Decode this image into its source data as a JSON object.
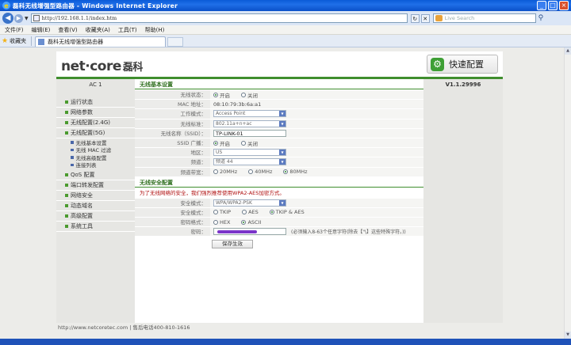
{
  "window": {
    "title": "磊科无线增强型路由器 - Windows Internet Explorer"
  },
  "address": {
    "url": "http://192.168.1.1/index.htm",
    "search_placeholder": "Live Search"
  },
  "menubar": [
    "文件(F)",
    "编辑(E)",
    "查看(V)",
    "收藏夹(A)",
    "工具(T)",
    "帮助(H)"
  ],
  "favorites": {
    "label": "收藏夹",
    "tab_title": "磊科无线增强型路由器"
  },
  "header": {
    "logo": "net·core",
    "logo_cn": "磊科",
    "quick_config": "快速配置"
  },
  "left": {
    "model": "AC 1",
    "menu": [
      {
        "label": "运行状态"
      },
      {
        "label": "网络参数"
      },
      {
        "label": "无线配置(2.4G)"
      },
      {
        "label": "无线配置(5G)"
      }
    ],
    "submenu": [
      "无线基本设置",
      "无线 MAC 过滤",
      "无线高级配置",
      "连接列表"
    ],
    "menu2": [
      "QoS 配置",
      "端口转发配置",
      "网络安全",
      "动态域名",
      "高级配置",
      "系统工具"
    ]
  },
  "right": {
    "version": "V1.1.29996"
  },
  "basic": {
    "title": "无线基本设置",
    "status_label": "无线状态：",
    "status_on": "开启",
    "status_off": "关闭",
    "mac_label": "MAC 地址：",
    "mac_value": "08:10:79:3b:6a:a1",
    "mode_label": "工作模式：",
    "mode_value": "Access Point",
    "std_label": "无线标准：",
    "std_value": "802.11a+n+ac",
    "ssid_label": "无线名称（SSID）：",
    "ssid_value": "TP-LINK-01",
    "bcast_label": "SSID 广播：",
    "bcast_on": "开启",
    "bcast_off": "关闭",
    "region_label": "地区：",
    "region_value": "US",
    "channel_label": "频道：",
    "channel_value": "频道 44",
    "bw_label": "频道带宽：",
    "bw_20": "20MHz",
    "bw_40": "40MHz",
    "bw_80": "80MHz"
  },
  "security": {
    "title": "无线安全配置",
    "warning": "为了无线网络的安全，我们强烈推荐使用WPA2-AES加密方式。",
    "mode_label": "安全模式：",
    "mode_value": "WPA/WPA2-PSK",
    "algo_label": "安全模式：",
    "algo_tkip": "TKIP",
    "algo_aes": "AES",
    "algo_both": "TKIP & AES",
    "fmt_label": "密码格式：",
    "fmt_hex": "HEX",
    "fmt_ascii": "ASCII",
    "pw_label": "密码：",
    "pw_hint": "(必须输入8-63个任意字符(除去【\"\\】这些特殊字符。))",
    "save": "保存生效"
  },
  "footer": {
    "text": "http://www.netcoretec.com | 售后电话400-810-1616"
  }
}
